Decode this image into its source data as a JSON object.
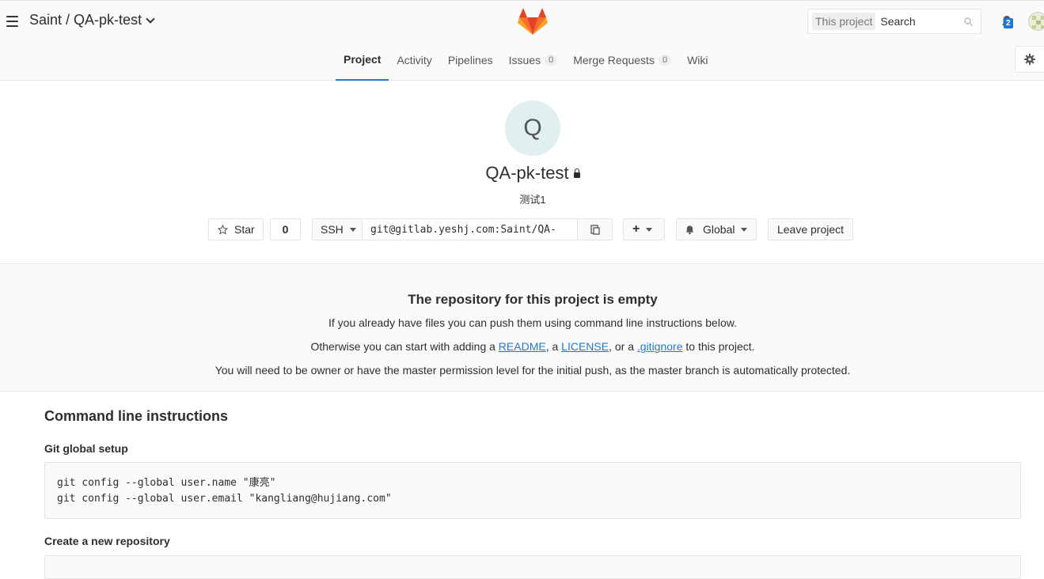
{
  "header": {
    "namespace": "Saint",
    "separator": "/",
    "project": "QA-pk-test",
    "search_scope": "This project",
    "search_placeholder": "Search",
    "notification_count": "2"
  },
  "nav": {
    "tabs": [
      {
        "label": "Project",
        "active": true
      },
      {
        "label": "Activity"
      },
      {
        "label": "Pipelines"
      },
      {
        "label": "Issues",
        "count": "0"
      },
      {
        "label": "Merge Requests",
        "count": "0"
      },
      {
        "label": "Wiki"
      }
    ]
  },
  "project": {
    "avatar_letter": "Q",
    "title": "QA-pk-test",
    "description": "测试1",
    "star_label": "Star",
    "star_count": "0",
    "protocol": "SSH",
    "clone_url": "git@gitlab.yeshj.com:Saint/QA-",
    "add_label": "+",
    "notification_level": "Global",
    "leave_label": "Leave project"
  },
  "empty": {
    "title": "The repository for this project is empty",
    "line1": "If you already have files you can push them using command line instructions below.",
    "line2_prefix": "Otherwise you can start with adding a ",
    "readme": "README",
    "sep1": ", a ",
    "license": "LICENSE",
    "sep2": ", or a ",
    "gitignore": ".gitignore",
    "line2_suffix": " to this project.",
    "line3": "You will need to be owner or have the master permission level for the initial push, as the master branch is automatically protected."
  },
  "cli": {
    "title": "Command line instructions",
    "global_setup": "Git global setup",
    "global_line1": "git config --global user.name \"康亮\"",
    "global_line2": "git config --global user.email \"kangliang@hujiang.com\"",
    "new_repo": "Create a new repository"
  },
  "colors": {
    "accent": "#1f78d1",
    "logo_orange": "#fc6d26",
    "logo_red": "#e24329",
    "logo_light": "#fca326"
  }
}
